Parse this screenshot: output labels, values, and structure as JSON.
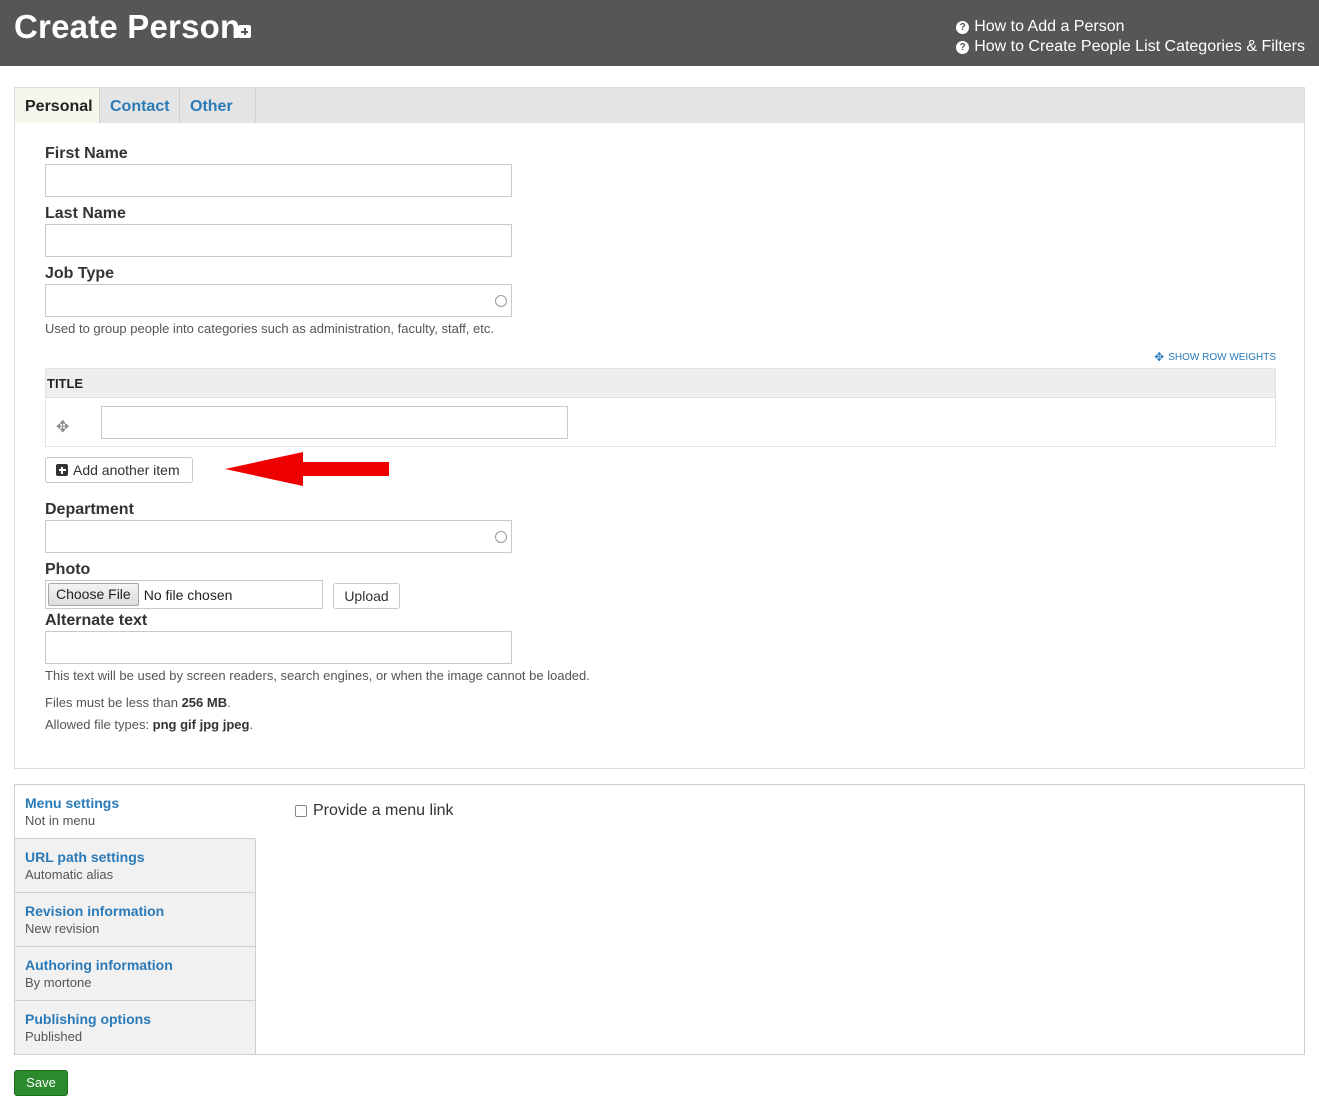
{
  "header": {
    "title": "Create Person",
    "help_links": [
      {
        "label": "How to Add a Person"
      },
      {
        "label": "How to Create People List Categories & Filters"
      }
    ]
  },
  "tabs": [
    {
      "label": "Personal",
      "active": true
    },
    {
      "label": "Contact",
      "active": false
    },
    {
      "label": "Other",
      "active": false
    }
  ],
  "fields": {
    "first_name": {
      "label": "First Name",
      "value": ""
    },
    "last_name": {
      "label": "Last Name",
      "value": ""
    },
    "job_type": {
      "label": "Job Type",
      "value": "",
      "description": "Used to group people into categories such as administration, faculty, staff, etc."
    },
    "show_row_weights": "Show row weights",
    "title": {
      "header": "TITLE",
      "value": ""
    },
    "add_another_item": "Add another item",
    "department": {
      "label": "Department",
      "value": ""
    },
    "photo": {
      "label": "Photo",
      "choose_file": "Choose File",
      "file_status": "No file chosen",
      "upload": "Upload"
    },
    "alt_text": {
      "label": "Alternate text",
      "value": "",
      "description": "This text will be used by screen readers, search engines, or when the image cannot be loaded."
    },
    "file_size_prefix": "Files must be less than ",
    "file_size_value": "256 MB",
    "file_size_suffix": ".",
    "file_types_prefix": "Allowed file types: ",
    "file_types_value": "png gif jpg jpeg",
    "file_types_suffix": "."
  },
  "vertical_tabs": [
    {
      "title": "Menu settings",
      "summary": "Not in menu",
      "active": true
    },
    {
      "title": "URL path settings",
      "summary": "Automatic alias",
      "active": false
    },
    {
      "title": "Revision information",
      "summary": "New revision",
      "active": false
    },
    {
      "title": "Authoring information",
      "summary": "By mortone",
      "active": false
    },
    {
      "title": "Publishing options",
      "summary": "Published",
      "active": false
    }
  ],
  "menu_settings": {
    "checkbox_label": "Provide a menu link",
    "checked": false
  },
  "actions": {
    "save": "Save"
  },
  "colors": {
    "header_bg": "#565656",
    "link": "#2a7ab8",
    "save_button": "#2b8a2b",
    "annotation_arrow": "#ee0000"
  }
}
